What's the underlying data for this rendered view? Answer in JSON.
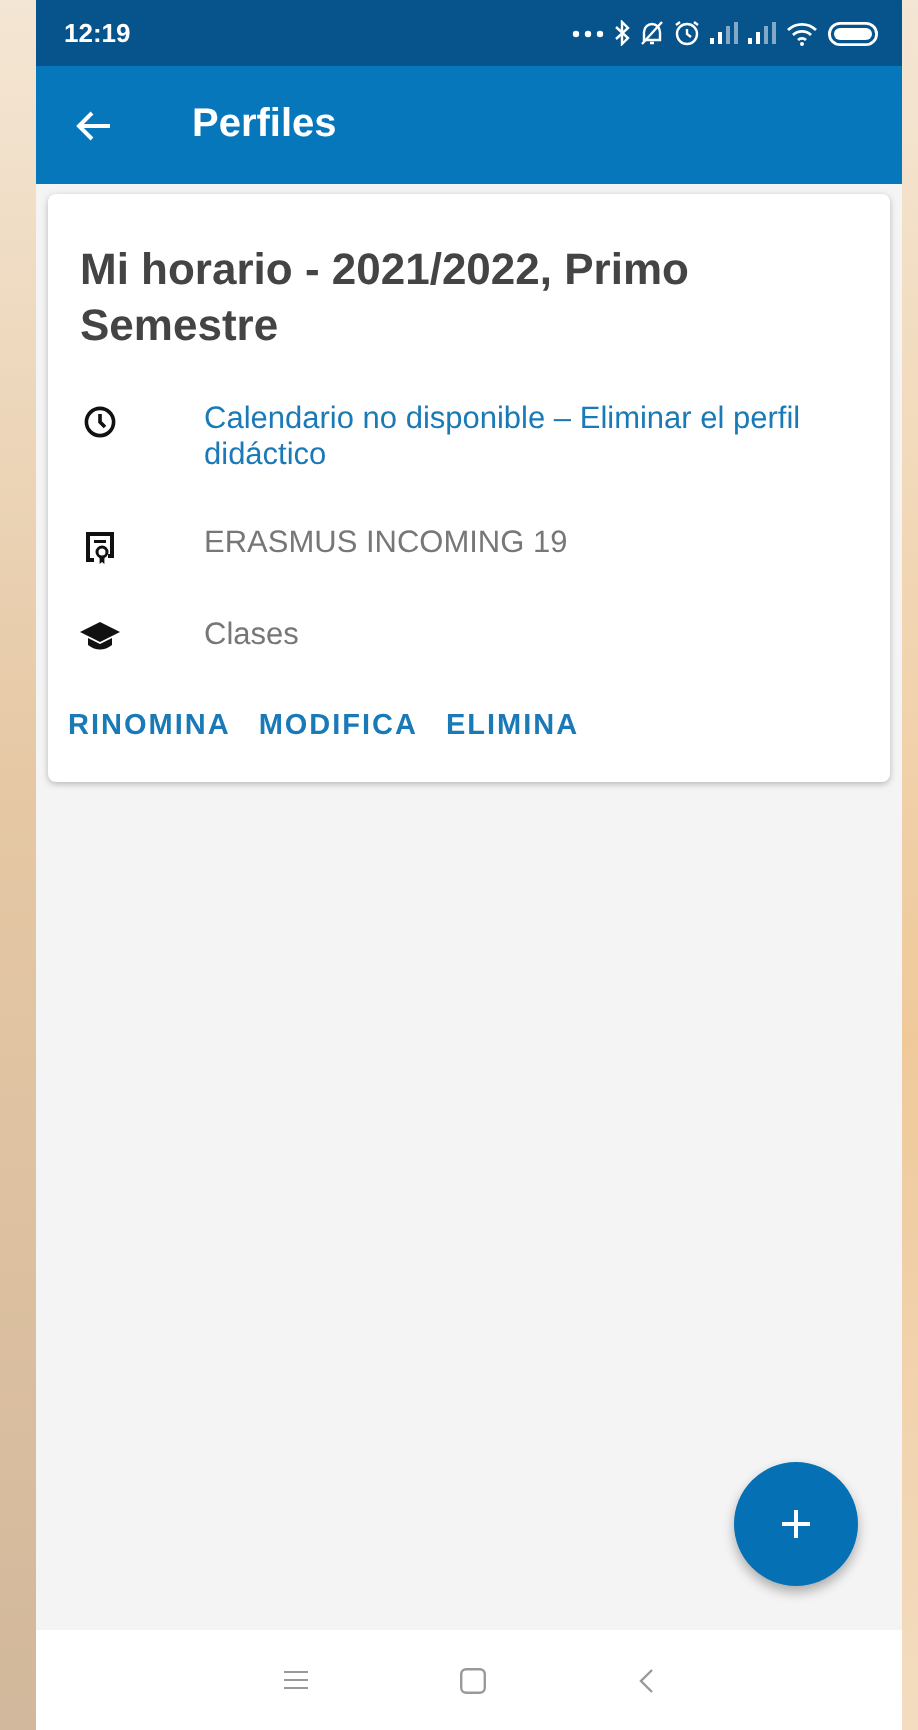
{
  "status_bar": {
    "time": "12:19"
  },
  "app_bar": {
    "title": "Perfiles"
  },
  "card": {
    "title": "Mi horario - 2021/2022, Primo Semestre",
    "rows": [
      {
        "kind": "link",
        "text": "Calendario no disponible – Eliminar el perfil didáctico"
      },
      {
        "kind": "plain",
        "text": "ERASMUS INCOMING 19"
      },
      {
        "kind": "plain",
        "text": "Clases"
      }
    ],
    "actions": [
      "RINOMINA",
      "MODIFICA",
      "ELIMINA"
    ]
  }
}
